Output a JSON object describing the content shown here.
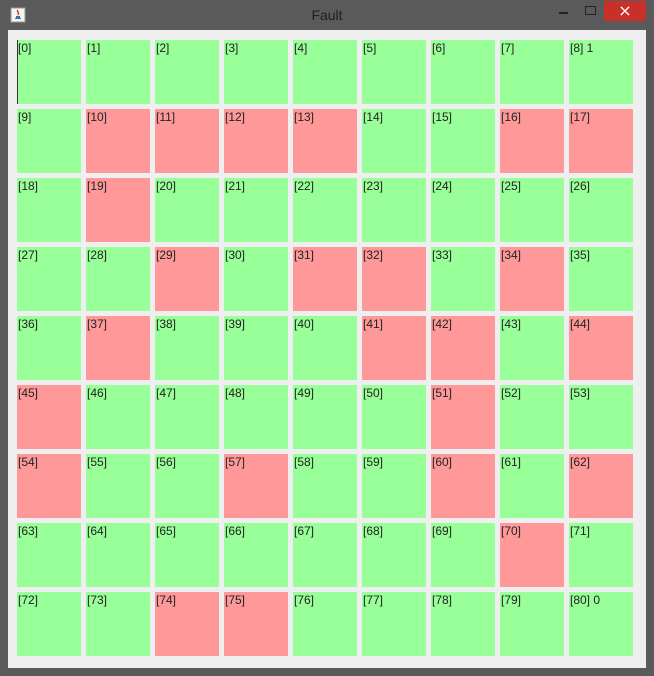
{
  "window": {
    "title": "Fault",
    "close_glyph": "×",
    "app_icon": "java-cup-icon"
  },
  "colors": {
    "ok": "#99ff99",
    "fault": "#ff9999",
    "close_button": "#c7312a"
  },
  "grid": {
    "rows": 9,
    "cols": 9,
    "cells": [
      {
        "label": "[0]",
        "state": "ok"
      },
      {
        "label": "[1]",
        "state": "ok"
      },
      {
        "label": "[2]",
        "state": "ok"
      },
      {
        "label": "[3]",
        "state": "ok"
      },
      {
        "label": "[4]",
        "state": "ok"
      },
      {
        "label": "[5]",
        "state": "ok"
      },
      {
        "label": "[6]",
        "state": "ok"
      },
      {
        "label": "[7]",
        "state": "ok"
      },
      {
        "label": "[8] 1",
        "state": "ok"
      },
      {
        "label": "[9]",
        "state": "ok"
      },
      {
        "label": "[10]",
        "state": "fault"
      },
      {
        "label": "[11]",
        "state": "fault"
      },
      {
        "label": "[12]",
        "state": "fault"
      },
      {
        "label": "[13]",
        "state": "fault"
      },
      {
        "label": "[14]",
        "state": "ok"
      },
      {
        "label": "[15]",
        "state": "ok"
      },
      {
        "label": "[16]",
        "state": "fault"
      },
      {
        "label": "[17]",
        "state": "fault"
      },
      {
        "label": "[18]",
        "state": "ok"
      },
      {
        "label": "[19]",
        "state": "fault"
      },
      {
        "label": "[20]",
        "state": "ok"
      },
      {
        "label": "[21]",
        "state": "ok"
      },
      {
        "label": "[22]",
        "state": "ok"
      },
      {
        "label": "[23]",
        "state": "ok"
      },
      {
        "label": "[24]",
        "state": "ok"
      },
      {
        "label": "[25]",
        "state": "ok"
      },
      {
        "label": "[26]",
        "state": "ok"
      },
      {
        "label": "[27]",
        "state": "ok"
      },
      {
        "label": "[28]",
        "state": "ok"
      },
      {
        "label": "[29]",
        "state": "fault"
      },
      {
        "label": "[30]",
        "state": "ok"
      },
      {
        "label": "[31]",
        "state": "fault"
      },
      {
        "label": "[32]",
        "state": "fault"
      },
      {
        "label": "[33]",
        "state": "ok"
      },
      {
        "label": "[34]",
        "state": "fault"
      },
      {
        "label": "[35]",
        "state": "ok"
      },
      {
        "label": "[36]",
        "state": "ok"
      },
      {
        "label": "[37]",
        "state": "fault"
      },
      {
        "label": "[38]",
        "state": "ok"
      },
      {
        "label": "[39]",
        "state": "ok"
      },
      {
        "label": "[40]",
        "state": "ok"
      },
      {
        "label": "[41]",
        "state": "fault"
      },
      {
        "label": "[42]",
        "state": "fault"
      },
      {
        "label": "[43]",
        "state": "ok"
      },
      {
        "label": "[44]",
        "state": "fault"
      },
      {
        "label": "[45]",
        "state": "fault"
      },
      {
        "label": "[46]",
        "state": "ok"
      },
      {
        "label": "[47]",
        "state": "ok"
      },
      {
        "label": "[48]",
        "state": "ok"
      },
      {
        "label": "[49]",
        "state": "ok"
      },
      {
        "label": "[50]",
        "state": "ok"
      },
      {
        "label": "[51]",
        "state": "fault"
      },
      {
        "label": "[52]",
        "state": "ok"
      },
      {
        "label": "[53]",
        "state": "ok"
      },
      {
        "label": "[54]",
        "state": "fault"
      },
      {
        "label": "[55]",
        "state": "ok"
      },
      {
        "label": "[56]",
        "state": "ok"
      },
      {
        "label": "[57]",
        "state": "fault"
      },
      {
        "label": "[58]",
        "state": "ok"
      },
      {
        "label": "[59]",
        "state": "ok"
      },
      {
        "label": "[60]",
        "state": "fault"
      },
      {
        "label": "[61]",
        "state": "ok"
      },
      {
        "label": "[62]",
        "state": "fault"
      },
      {
        "label": "[63]",
        "state": "ok"
      },
      {
        "label": "[64]",
        "state": "ok"
      },
      {
        "label": "[65]",
        "state": "ok"
      },
      {
        "label": "[66]",
        "state": "ok"
      },
      {
        "label": "[67]",
        "state": "ok"
      },
      {
        "label": "[68]",
        "state": "ok"
      },
      {
        "label": "[69]",
        "state": "ok"
      },
      {
        "label": "[70]",
        "state": "fault"
      },
      {
        "label": "[71]",
        "state": "ok"
      },
      {
        "label": "[72]",
        "state": "ok"
      },
      {
        "label": "[73]",
        "state": "ok"
      },
      {
        "label": "[74]",
        "state": "fault"
      },
      {
        "label": "[75]",
        "state": "fault"
      },
      {
        "label": "[76]",
        "state": "ok"
      },
      {
        "label": "[77]",
        "state": "ok"
      },
      {
        "label": "[78]",
        "state": "ok"
      },
      {
        "label": "[79]",
        "state": "ok"
      },
      {
        "label": "[80] 0",
        "state": "ok"
      }
    ]
  }
}
